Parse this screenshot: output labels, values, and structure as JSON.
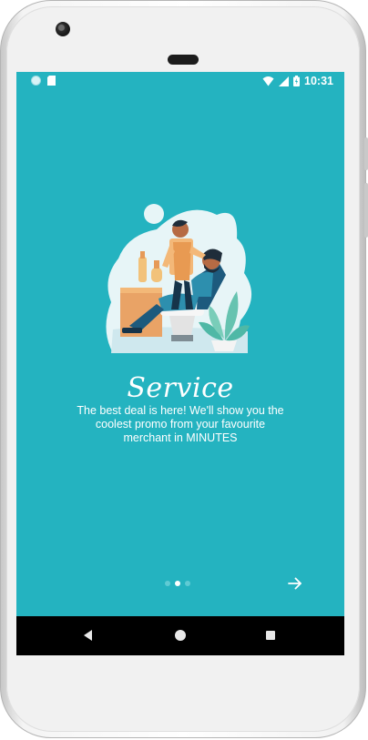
{
  "status_bar": {
    "time": "10:31"
  },
  "onboarding": {
    "title": "Service",
    "description": "The best deal is here! We'll show you the coolest promo from your favourite merchant in MINUTES",
    "page_count": 3,
    "active_page": 2
  },
  "colors": {
    "screen_background": "#24b3c0",
    "text": "#ffffff",
    "inactive_dot": "#5fcbd4"
  },
  "icons": {
    "next": "arrow-right-icon",
    "back": "back-triangle-icon",
    "home": "home-circle-icon",
    "recents": "recents-square-icon"
  }
}
